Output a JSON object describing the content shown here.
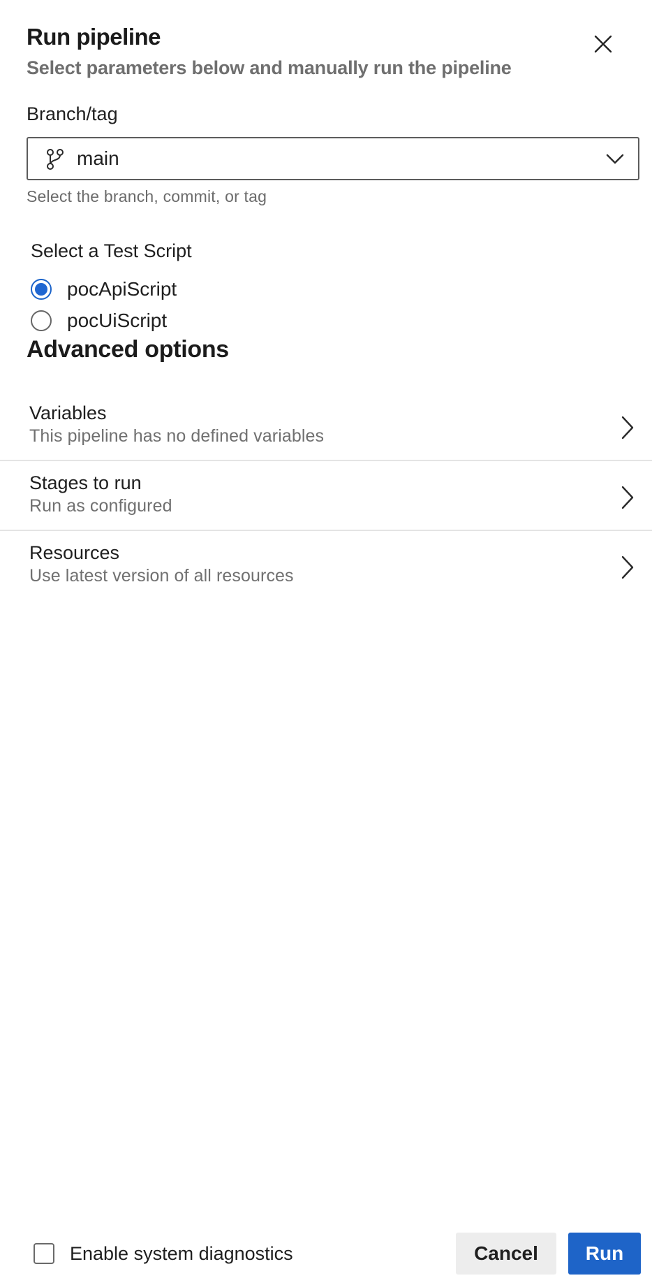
{
  "header": {
    "title": "Run pipeline",
    "subtitle": "Select parameters below and manually run the pipeline",
    "close_icon": "close-icon"
  },
  "branch_field": {
    "label": "Branch/tag",
    "value": "main",
    "help_text": "Select the branch, commit, or tag",
    "icon": "git-branch-icon"
  },
  "test_script": {
    "label": "Select a Test Script",
    "options": [
      {
        "label": "pocApiScript",
        "checked": true
      },
      {
        "label": "pocUiScript",
        "checked": false
      }
    ]
  },
  "advanced": {
    "title": "Advanced options",
    "items": [
      {
        "title": "Variables",
        "description": "This pipeline has no defined variables"
      },
      {
        "title": "Stages to run",
        "description": "Run as configured"
      },
      {
        "title": "Resources",
        "description": "Use latest version of all resources"
      }
    ]
  },
  "footer": {
    "diagnostics_label": "Enable system diagnostics",
    "diagnostics_checked": false,
    "cancel_label": "Cancel",
    "run_label": "Run"
  },
  "colors": {
    "accent": "#1e64c8",
    "muted_text": "#707070",
    "border": "#5c5c5c"
  }
}
